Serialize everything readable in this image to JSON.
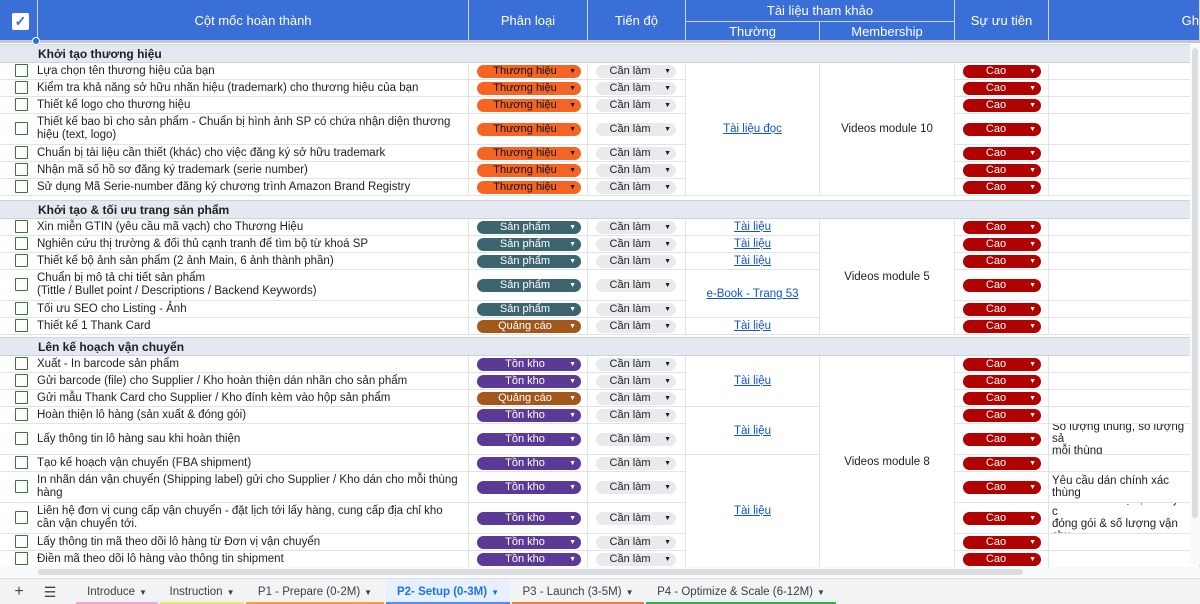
{
  "headers": {
    "milestone": "Cột mốc hoàn thành",
    "category": "Phân loại",
    "progress": "Tiến độ",
    "reference": "Tài liệu tham khảo",
    "ref_normal": "Thường",
    "ref_membership": "Membership",
    "priority": "Sự ưu tiên",
    "notes": "Gh"
  },
  "colors": {
    "header_bg": "#3b6fd8",
    "brand": "#f46524",
    "product": "#3d6570",
    "ads": "#a2571b",
    "inventory": "#5b3a96",
    "priority_high": "#b10202"
  },
  "sections": [
    "Khởi tạo thương hiệu",
    "Khởi tạo & tối ưu trang sản phẩm",
    "Lên kế hoạch vận chuyển"
  ],
  "rows": [
    {
      "task": "Lựa chọn tên thương hiệu của bạn",
      "category": "Thương hiệu",
      "cat": "brand",
      "progress": "Cần làm",
      "priority": "Cao",
      "note": ""
    },
    {
      "task": "Kiểm tra khả năng sở hữu nhãn hiệu (trademark) cho thương hiệu của bạn",
      "category": "Thương hiệu",
      "cat": "brand",
      "progress": "Cần làm",
      "priority": "Cao",
      "note": ""
    },
    {
      "task": "Thiết kế logo cho thương hiệu",
      "category": "Thương hiệu",
      "cat": "brand",
      "progress": "Cần làm",
      "priority": "Cao",
      "note": ""
    },
    {
      "task": "Thiết kế bao bì cho sản phẩm - Chuẩn bị hình ảnh SP có chứa nhận diện thương hiệu (text, logo)",
      "category": "Thương hiệu",
      "cat": "brand",
      "progress": "Cần làm",
      "priority": "Cao",
      "note": ""
    },
    {
      "task": "Chuẩn bị tài liệu cần thiết (khác) cho việc đăng ký sở hữu trademark",
      "category": "Thương hiệu",
      "cat": "brand",
      "progress": "Cần làm",
      "priority": "Cao",
      "note": ""
    },
    {
      "task": "Nhận mã số hồ sơ đăng ký trademark (serie number)",
      "category": "Thương hiệu",
      "cat": "brand",
      "progress": "Cần làm",
      "priority": "Cao",
      "note": ""
    },
    {
      "task": "Sử dụng Mã Serie-number đăng ký chương trình Amazon Brand Registry",
      "category": "Thương hiệu",
      "cat": "brand",
      "progress": "Cần làm",
      "priority": "Cao",
      "note": ""
    },
    {
      "task": "Xin miễn GTIN (yêu cầu mã vạch) cho Thương Hiệu",
      "category": "Sản phẩm",
      "cat": "product",
      "progress": "Cần làm",
      "priority": "Cao",
      "note": ""
    },
    {
      "task": "Nghiên cứu thị trường & đối thủ cạnh tranh để tìm bộ từ khoá SP",
      "category": "Sản phẩm",
      "cat": "product",
      "progress": "Cần làm",
      "priority": "Cao",
      "note": ""
    },
    {
      "task": "Thiết kế bộ ảnh sản phẩm (2 ảnh Main, 6 ảnh thành phần)",
      "category": "Sản phẩm",
      "cat": "product",
      "progress": "Cần làm",
      "priority": "Cao",
      "note": ""
    },
    {
      "task": "Chuẩn bị mô tả chi tiết sản phẩm\n(Tittle / Bullet point / Descriptions / Backend Keywords)",
      "category": "Sản phẩm",
      "cat": "product",
      "progress": "Cần làm",
      "priority": "Cao",
      "note": ""
    },
    {
      "task": "Tối ưu SEO cho Listing - Ảnh",
      "category": "Sản phẩm",
      "cat": "product",
      "progress": "Cần làm",
      "priority": "Cao",
      "note": ""
    },
    {
      "task": "Thiết kế 1 Thank Card",
      "category": "Quảng cáo",
      "cat": "ads",
      "progress": "Cần làm",
      "priority": "Cao",
      "note": ""
    },
    {
      "task": "Xuất - In barcode sản phẩm",
      "category": "Tồn kho",
      "cat": "inventory",
      "progress": "Cần làm",
      "priority": "Cao",
      "note": ""
    },
    {
      "task": "Gửi barcode (file) cho Supplier / Kho hoàn thiện dán nhãn cho sản phẩm",
      "category": "Tồn kho",
      "cat": "inventory",
      "progress": "Cần làm",
      "priority": "Cao",
      "note": ""
    },
    {
      "task": "Gửi mẫu Thank Card cho Supplier / Kho đính kèm vào hộp sản phẩm",
      "category": "Quảng cáo",
      "cat": "ads",
      "progress": "Cần làm",
      "priority": "Cao",
      "note": ""
    },
    {
      "task": "Hoàn thiện lô hàng (sản xuất & đóng gói)",
      "category": "Tồn kho",
      "cat": "inventory",
      "progress": "Cần làm",
      "priority": "Cao",
      "note": ""
    },
    {
      "task": "Lấy thông tin lô hàng sau khi hoàn thiện",
      "category": "Tồn kho",
      "cat": "inventory",
      "progress": "Cần làm",
      "priority": "Cao",
      "note": "Số lượng thùng, số lượng sả\nmỗi thùng"
    },
    {
      "task": "Tạo kế hoạch vận chuyển (FBA shipment)",
      "category": "Tồn kho",
      "cat": "inventory",
      "progress": "Cần làm",
      "priority": "Cao",
      "note": ""
    },
    {
      "task": "In nhãn dán vận chuyển (Shipping label) gửi cho Supplier / Kho dán cho mỗi thùng hàng",
      "category": "Tồn kho",
      "cat": "inventory",
      "progress": "Cần làm",
      "priority": "Cao",
      "note": "Yêu cầu dán chính xác thùng"
    },
    {
      "task": "Liên hệ đơn vị cung cấp vận chuyển - đặt lịch tới lấy hàng, cung cấp địa chỉ kho cần vận chuyển tới.",
      "category": "Tồn kho",
      "cat": "inventory",
      "progress": "Cần làm",
      "priority": "Cao",
      "note": "Yêu cầu đơn vị vận chuyển c\nđóng gói & số lượng vận chu"
    },
    {
      "task": "Lấy thông tin mã theo dõi lô hàng từ Đơn vị vận chuyển",
      "category": "Tồn kho",
      "cat": "inventory",
      "progress": "Cần làm",
      "priority": "Cao",
      "note": ""
    },
    {
      "task": "Điền mã theo dõi lô hàng vào thông tin shipment",
      "category": "Tồn kho",
      "cat": "inventory",
      "progress": "Cần làm",
      "priority": "Cao",
      "note": ""
    }
  ],
  "refs_normal": [
    {
      "text": "Tài liệu đọc",
      "link": true
    },
    {
      "text": "Tài liệu",
      "link": true
    },
    {
      "text": "Tài liệu",
      "link": true
    },
    {
      "text": "Tài liệu",
      "link": true
    },
    {
      "text": "e-Book - Trang 53",
      "link": true
    },
    {
      "text": "Tài liệu",
      "link": true
    },
    {
      "text": "Tài liệu",
      "link": true
    },
    {
      "text": "Tài liệu",
      "link": true
    },
    {
      "text": "Tài liệu",
      "link": true
    }
  ],
  "refs_membership": [
    {
      "text": "Videos module 10"
    },
    {
      "text": "Videos module 5"
    },
    {
      "text": "Videos module 8"
    }
  ],
  "tabs": [
    {
      "label": "Introduce",
      "color": "#f4a6d7"
    },
    {
      "label": "Instruction",
      "color": "#e8ea63"
    },
    {
      "label": "P1 - Prepare (0-2M)",
      "color": "#ff9d34"
    },
    {
      "label": "P2- Setup (0-3M)",
      "color": "#4f8ef7"
    },
    {
      "label": "P3 - Launch (3-5M)",
      "color": "#f07b36"
    },
    {
      "label": "P4 - Optimize & Scale (6-12M)",
      "color": "#36b24a"
    }
  ],
  "icons": {
    "add": "plus-icon",
    "menu": "sheets-menu-icon",
    "dropdown": "chevron-down-icon",
    "checkbox": "checkbox-icon"
  }
}
